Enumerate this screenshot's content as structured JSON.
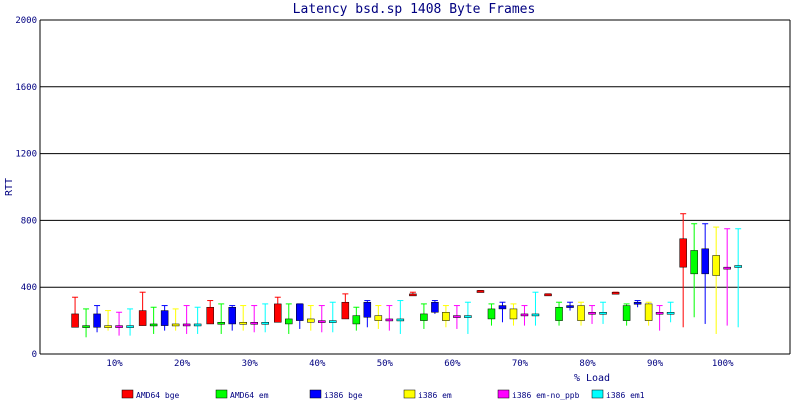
{
  "chart_data": {
    "type": "boxplot",
    "title": "Latency bsd.sp 1408 Byte Frames",
    "xlabel": "% Load",
    "ylabel": "RTT",
    "ylim": [
      0,
      2000
    ],
    "yticks": [
      "0",
      "400",
      "800",
      "1200",
      "1600",
      "2000"
    ],
    "categories": [
      "10%",
      "20%",
      "30%",
      "40%",
      "50%",
      "60%",
      "70%",
      "80%",
      "90%",
      "100%"
    ],
    "grid": true,
    "legend_position": "bottom",
    "series": [
      {
        "name": "AMD64 bge",
        "color": "#ff0000",
        "box": [
          {
            "min": 160,
            "q1": 160,
            "q3": 240,
            "max": 340
          },
          {
            "min": 170,
            "q1": 170,
            "q3": 260,
            "max": 370
          },
          {
            "min": 180,
            "q1": 180,
            "q3": 280,
            "max": 320
          },
          {
            "min": 190,
            "q1": 190,
            "q3": 300,
            "max": 340
          },
          {
            "min": 210,
            "q1": 210,
            "q3": 310,
            "max": 360
          },
          {
            "min": 360,
            "q1": 360,
            "q3": 360,
            "max": 370
          },
          {
            "min": 370,
            "q1": 370,
            "q3": 380,
            "max": 380
          },
          {
            "min": 350,
            "q1": 350,
            "q3": 360,
            "max": 360
          },
          {
            "min": 360,
            "q1": 360,
            "q3": 370,
            "max": 370
          },
          {
            "min": 160,
            "q1": 520,
            "q3": 690,
            "max": 840
          }
        ]
      },
      {
        "name": "AMD64 em",
        "color": "#00ff00",
        "box": [
          {
            "min": 100,
            "q1": 160,
            "q3": 170,
            "max": 270
          },
          {
            "min": 120,
            "q1": 170,
            "q3": 180,
            "max": 280
          },
          {
            "min": 120,
            "q1": 180,
            "q3": 190,
            "max": 300
          },
          {
            "min": 120,
            "q1": 180,
            "q3": 210,
            "max": 300
          },
          {
            "min": 140,
            "q1": 180,
            "q3": 230,
            "max": 280
          },
          {
            "min": 150,
            "q1": 200,
            "q3": 240,
            "max": 300
          },
          {
            "min": 170,
            "q1": 210,
            "q3": 270,
            "max": 300
          },
          {
            "min": 170,
            "q1": 200,
            "q3": 280,
            "max": 310
          },
          {
            "min": 170,
            "q1": 200,
            "q3": 290,
            "max": 300
          },
          {
            "min": 220,
            "q1": 480,
            "q3": 620,
            "max": 780
          }
        ]
      },
      {
        "name": "i386 bge",
        "color": "#0000ff",
        "box": [
          {
            "min": 130,
            "q1": 160,
            "q3": 240,
            "max": 290
          },
          {
            "min": 140,
            "q1": 170,
            "q3": 260,
            "max": 290
          },
          {
            "min": 140,
            "q1": 180,
            "q3": 280,
            "max": 290
          },
          {
            "min": 150,
            "q1": 200,
            "q3": 300,
            "max": 300
          },
          {
            "min": 160,
            "q1": 220,
            "q3": 310,
            "max": 320
          },
          {
            "min": 240,
            "q1": 250,
            "q3": 310,
            "max": 320
          },
          {
            "min": 190,
            "q1": 270,
            "q3": 290,
            "max": 310
          },
          {
            "min": 260,
            "q1": 290,
            "q3": 290,
            "max": 310
          },
          {
            "min": 280,
            "q1": 300,
            "q3": 310,
            "max": 320
          },
          {
            "min": 180,
            "q1": 480,
            "q3": 630,
            "max": 780
          }
        ]
      },
      {
        "name": "i386 em",
        "color": "#ffff00",
        "box": [
          {
            "min": 140,
            "q1": 160,
            "q3": 170,
            "max": 260
          },
          {
            "min": 140,
            "q1": 170,
            "q3": 180,
            "max": 270
          },
          {
            "min": 140,
            "q1": 180,
            "q3": 190,
            "max": 290
          },
          {
            "min": 140,
            "q1": 190,
            "q3": 210,
            "max": 290
          },
          {
            "min": 150,
            "q1": 200,
            "q3": 230,
            "max": 290
          },
          {
            "min": 160,
            "q1": 200,
            "q3": 250,
            "max": 290
          },
          {
            "min": 170,
            "q1": 210,
            "q3": 270,
            "max": 300
          },
          {
            "min": 170,
            "q1": 200,
            "q3": 290,
            "max": 310
          },
          {
            "min": 170,
            "q1": 200,
            "q3": 300,
            "max": 310
          },
          {
            "min": 120,
            "q1": 470,
            "q3": 590,
            "max": 760
          }
        ]
      },
      {
        "name": "i386 em-no_ppb",
        "color": "#ff00ff",
        "box": [
          {
            "min": 110,
            "q1": 160,
            "q3": 170,
            "max": 250
          },
          {
            "min": 120,
            "q1": 170,
            "q3": 180,
            "max": 290
          },
          {
            "min": 130,
            "q1": 180,
            "q3": 190,
            "max": 290
          },
          {
            "min": 130,
            "q1": 190,
            "q3": 200,
            "max": 290
          },
          {
            "min": 140,
            "q1": 200,
            "q3": 210,
            "max": 290
          },
          {
            "min": 150,
            "q1": 220,
            "q3": 230,
            "max": 290
          },
          {
            "min": 170,
            "q1": 230,
            "q3": 240,
            "max": 290
          },
          {
            "min": 180,
            "q1": 240,
            "q3": 250,
            "max": 290
          },
          {
            "min": 140,
            "q1": 240,
            "q3": 250,
            "max": 290
          },
          {
            "min": 170,
            "q1": 510,
            "q3": 520,
            "max": 750
          }
        ]
      },
      {
        "name": "i386 em1",
        "color": "#00ffff",
        "box": [
          {
            "min": 110,
            "q1": 160,
            "q3": 170,
            "max": 270
          },
          {
            "min": 120,
            "q1": 170,
            "q3": 180,
            "max": 280
          },
          {
            "min": 130,
            "q1": 180,
            "q3": 190,
            "max": 300
          },
          {
            "min": 130,
            "q1": 190,
            "q3": 200,
            "max": 310
          },
          {
            "min": 120,
            "q1": 200,
            "q3": 210,
            "max": 320
          },
          {
            "min": 120,
            "q1": 220,
            "q3": 230,
            "max": 310
          },
          {
            "min": 170,
            "q1": 230,
            "q3": 240,
            "max": 370
          },
          {
            "min": 180,
            "q1": 240,
            "q3": 250,
            "max": 310
          },
          {
            "min": 190,
            "q1": 240,
            "q3": 250,
            "max": 310
          },
          {
            "min": 160,
            "q1": 520,
            "q3": 530,
            "max": 750
          }
        ]
      }
    ]
  }
}
